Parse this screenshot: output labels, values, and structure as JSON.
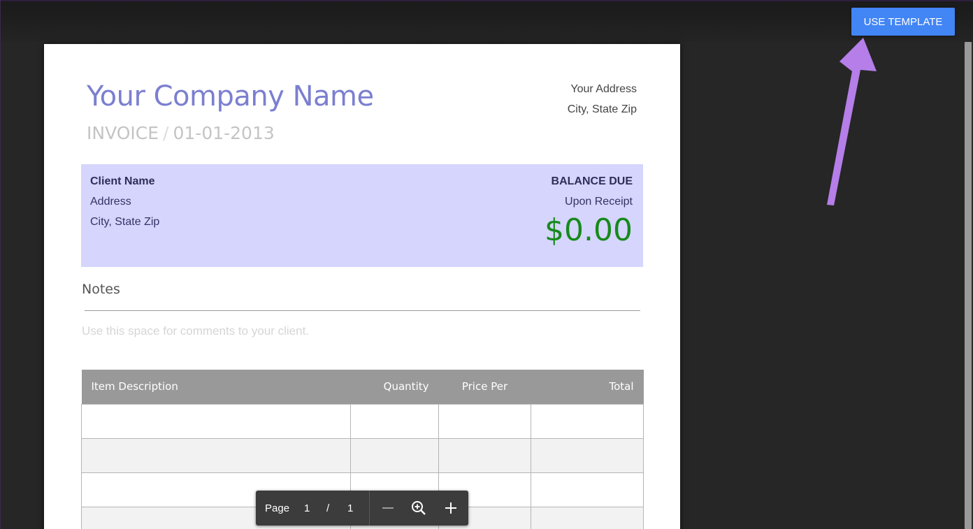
{
  "toolbar": {
    "use_template_label": "USE TEMPLATE"
  },
  "invoice": {
    "company_name": "Your Company Name",
    "doc_type": "INVOICE",
    "separator": "/",
    "date": "01-01-2013",
    "company_address_line1": "Your Address",
    "company_address_line2": "City, State Zip",
    "client": {
      "name": "Client Name",
      "address": "Address",
      "city_state_zip": "City, State Zip"
    },
    "balance": {
      "label": "BALANCE DUE",
      "terms": "Upon Receipt",
      "amount": "$0.00"
    },
    "notes": {
      "heading": "Notes",
      "placeholder": "Use this space for comments to your client."
    },
    "table": {
      "headers": [
        "Item Description",
        "Quantity",
        "Price Per",
        "Total"
      ],
      "rows": [
        [
          "",
          "",
          "",
          ""
        ],
        [
          "",
          "",
          "",
          ""
        ],
        [
          "",
          "",
          "",
          ""
        ],
        [
          "",
          "",
          "",
          ""
        ]
      ]
    }
  },
  "pager": {
    "label": "Page",
    "current": "1",
    "slash": "/",
    "total": "1",
    "icons": [
      "zoom-out-icon",
      "zoom-fit-icon",
      "zoom-in-icon"
    ]
  },
  "colors": {
    "accent_button": "#4285f4",
    "company_name": "#7b7fd0",
    "client_box": "#d5d5fd",
    "amount": "#168a1b",
    "table_header": "#999999",
    "annotation_arrow": "#b57ee8"
  }
}
